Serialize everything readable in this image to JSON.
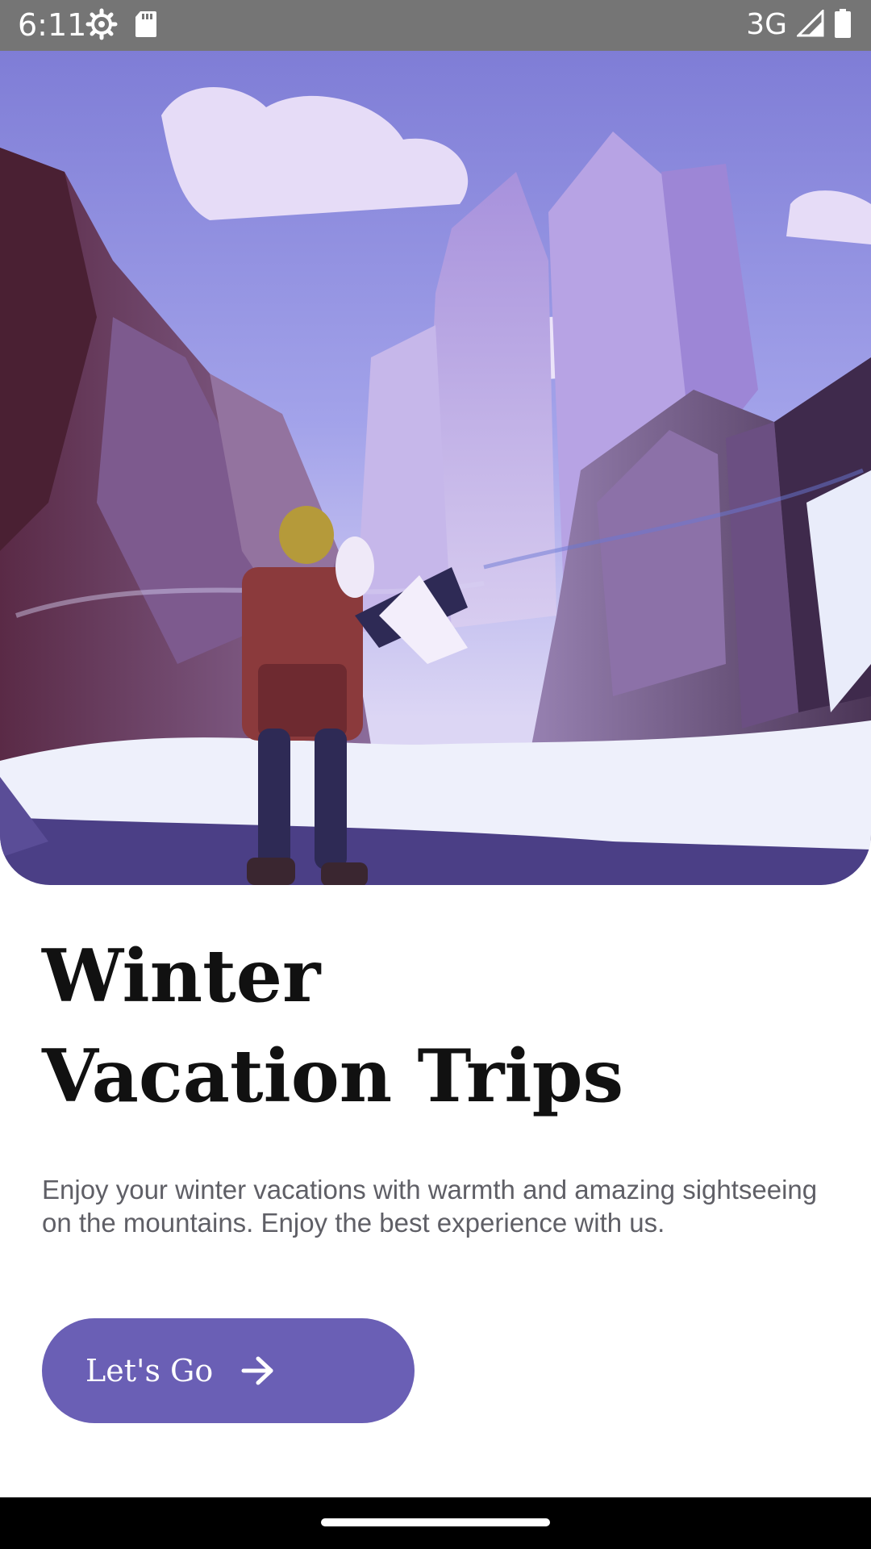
{
  "status_bar": {
    "time": "6:11",
    "network": "3G",
    "left_icons": [
      "settings-icon",
      "sd-card-icon"
    ],
    "right_icons": [
      "signal-icon",
      "battery-icon"
    ]
  },
  "hero": {
    "image": "winter-mountain-hiker-illustration",
    "colors": {
      "sky": "#8a88de",
      "rock": "#7b5a8d",
      "snow": "#eef0fb"
    }
  },
  "title": {
    "line1": "Winter",
    "line2": "Vacation Trips"
  },
  "description": "Enjoy your winter vacations with warmth and amazing sightseeing on the mountains. Enjoy the best experience with us.",
  "cta": {
    "label": "Let's Go",
    "icon": "arrow-right-icon",
    "color": "#6a5fb5"
  }
}
